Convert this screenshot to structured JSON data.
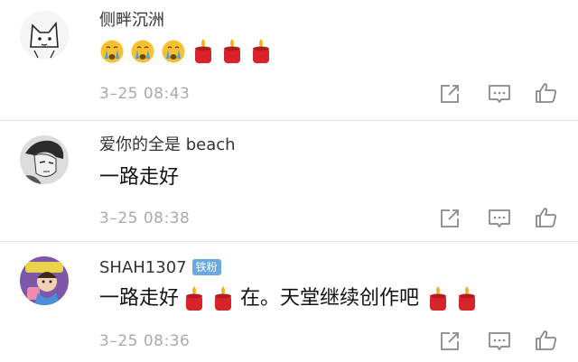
{
  "comments": [
    {
      "username": "侧畔沉洲",
      "badge": "",
      "text_parts": [],
      "emojis": [
        "crying-face-icon",
        "crying-face-icon",
        "crying-face-icon",
        "candle-icon",
        "candle-icon",
        "candle-icon"
      ],
      "time": "3–25 08:43"
    },
    {
      "username": "爱你的全是 beach",
      "badge": "",
      "text_parts": [
        "一路走好"
      ],
      "emojis": [],
      "time": "3–25 08:38"
    },
    {
      "username": "SHAH1307",
      "badge": "铁粉",
      "text_parts": [
        "一路走好",
        "在。天堂继续创作吧"
      ],
      "emojis": [
        "candle-icon",
        "candle-icon",
        "candle-icon",
        "candle-icon"
      ],
      "time": "3–25 08:36"
    }
  ],
  "actions": [
    "share-icon",
    "comment-icon",
    "like-icon"
  ],
  "colors": {
    "username": "#333333",
    "content": "#111111",
    "meta": "#aaaaaa",
    "icon_stroke": "#888888",
    "divider": "#e6e6e6",
    "badge_bg": "#6aa8e0",
    "candle_red": "#d9232a",
    "flame": "#f6b21c",
    "crying_face": "#f5c12e",
    "tears": "#4aa0e8"
  }
}
